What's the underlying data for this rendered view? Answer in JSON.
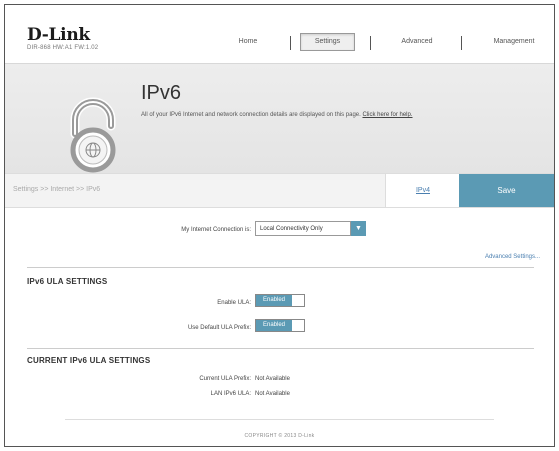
{
  "header": {
    "brand": "D-Link",
    "model_info": "DIR-868 HW:A1 FW:1.02",
    "nav": {
      "home": "Home",
      "settings": "Settings",
      "advanced": "Advanced",
      "management": "Management"
    }
  },
  "banner": {
    "title": "IPv6",
    "description": "All of your IPv6 Internet and network connection details are displayed on this page.",
    "help_link": "Click here for help."
  },
  "toolbar": {
    "breadcrumb": "Settings >> Internet >> IPv6",
    "ipv4_label": "IPv4",
    "save_label": "Save"
  },
  "connection": {
    "label": "My Internet Connection is:",
    "selected": "Local Connectivity Only",
    "advanced_link": "Advanced Settings..."
  },
  "ula_settings": {
    "title": "IPv6 ULA SETTINGS",
    "enable_ula_label": "Enable ULA:",
    "enable_ula_value": "Enabled",
    "default_prefix_label": "Use Default ULA Prefix:",
    "default_prefix_value": "Enabled"
  },
  "current_ula": {
    "title": "CURRENT IPv6 ULA SETTINGS",
    "prefix_label": "Current ULA Prefix:",
    "prefix_value": "Not Available",
    "lan_label": "LAN IPv6 ULA:",
    "lan_value": "Not Available"
  },
  "footer": {
    "copyright": "COPYRIGHT © 2013 D-Link"
  },
  "colors": {
    "accent": "#5b9ab4",
    "link": "#4a7fb0"
  }
}
